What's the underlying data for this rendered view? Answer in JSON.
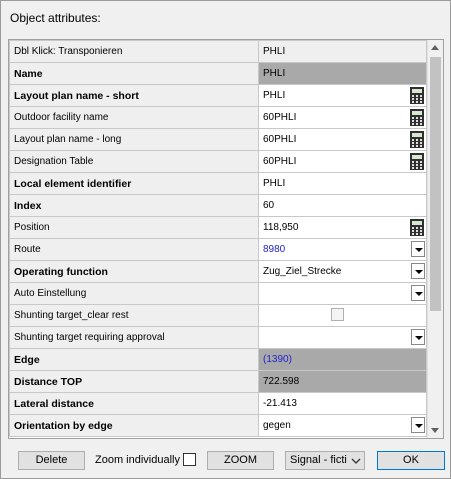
{
  "dialog": {
    "title": "Object attributes:"
  },
  "header": {
    "label": "Dbl Klick: Transponieren",
    "value": "PHLI"
  },
  "rows": [
    {
      "label": "Name",
      "value": "PHLI"
    },
    {
      "label": "Layout plan name - short",
      "value": "PHLI"
    },
    {
      "label": "Outdoor facility name",
      "value": "60PHLI"
    },
    {
      "label": "Layout plan name - long",
      "value": "60PHLI"
    },
    {
      "label": "Designation Table",
      "value": "60PHLI"
    },
    {
      "label": "Local element identifier",
      "value": "PHLI"
    },
    {
      "label": "Index",
      "value": "60"
    },
    {
      "label": "Position",
      "value": "118,950"
    },
    {
      "label": "Route",
      "value": "8980"
    },
    {
      "label": "Operating function",
      "value": "Zug_Ziel_Strecke"
    },
    {
      "label": "Auto Einstellung",
      "value": ""
    },
    {
      "label": "Shunting target_clear rest",
      "value": ""
    },
    {
      "label": "Shunting target requiring approval",
      "value": ""
    },
    {
      "label": "Edge",
      "value": "(1390)"
    },
    {
      "label": "Distance TOP",
      "value": "722.598"
    },
    {
      "label": "Lateral distance",
      "value": "-21.413"
    },
    {
      "label": "Orientation by edge",
      "value": "gegen"
    }
  ],
  "footer": {
    "delete_label": "Delete",
    "zoom_individually_label": "Zoom individually",
    "zoom_label": "ZOOM",
    "signal_select_value": "Signal - ficti",
    "ok_label": "OK"
  },
  "colors": {
    "ok_border": "#0078d7",
    "link_blue": "#2222cc",
    "readonly_grey": "#a9a9a9"
  }
}
